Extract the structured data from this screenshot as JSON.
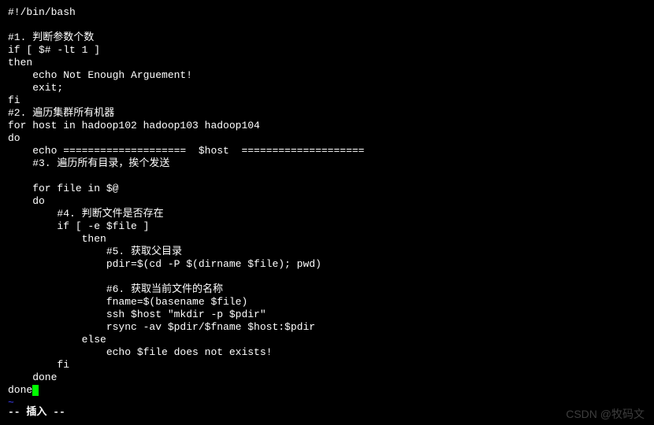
{
  "script": {
    "lines": [
      "#!/bin/bash",
      "",
      "#1. 判断参数个数",
      "if [ $# -lt 1 ]",
      "then",
      "    echo Not Enough Arguement!",
      "    exit;",
      "fi",
      "#2. 遍历集群所有机器",
      "for host in hadoop102 hadoop103 hadoop104",
      "do",
      "    echo ====================  $host  ====================",
      "    #3. 遍历所有目录，挨个发送",
      "",
      "    for file in $@",
      "    do",
      "        #4. 判断文件是否存在",
      "        if [ -e $file ]",
      "            then",
      "                #5. 获取父目录",
      "                pdir=$(cd -P $(dirname $file); pwd)",
      "",
      "                #6. 获取当前文件的名称",
      "                fname=$(basename $file)",
      "                ssh $host \"mkdir -p $pdir\"",
      "                rsync -av $pdir/$fname $host:$pdir",
      "            else",
      "                echo $file does not exists!",
      "        fi",
      "    done",
      "done"
    ]
  },
  "editor": {
    "tilde": "~",
    "mode_status": "-- 插入 --"
  },
  "watermark": "CSDN @牧码文"
}
